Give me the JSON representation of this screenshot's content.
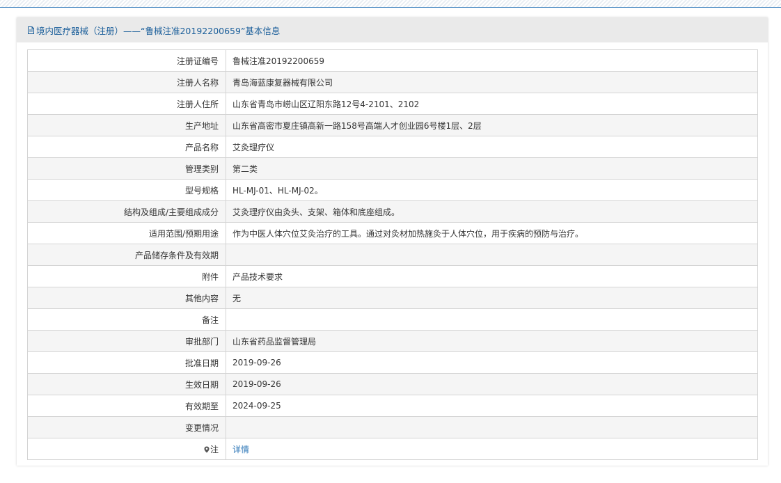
{
  "header": {
    "title": "境内医疗器械（注册）——“鲁械注准20192200659”基本信息"
  },
  "rows": [
    {
      "label": "注册证编号",
      "value": "鲁械注准20192200659"
    },
    {
      "label": "注册人名称",
      "value": "青岛海蓝康复器械有限公司"
    },
    {
      "label": "注册人住所",
      "value": "山东省青岛市崂山区辽阳东路12号4-2101、2102"
    },
    {
      "label": "生产地址",
      "value": "山东省高密市夏庄镇高新一路158号高端人才创业园6号楼1层、2层"
    },
    {
      "label": "产品名称",
      "value": "艾灸理疗仪"
    },
    {
      "label": "管理类别",
      "value": "第二类"
    },
    {
      "label": "型号规格",
      "value": "HL-MJ-01、HL-MJ-02。"
    },
    {
      "label": "结构及组成/主要组成成分",
      "value": "艾灸理疗仪由灸头、支架、箱体和底座组成。"
    },
    {
      "label": "适用范围/预期用途",
      "value": "作为中医人体穴位艾灸治疗的工具。通过对灸材加热施灸于人体穴位，用于疾病的预防与治疗。"
    },
    {
      "label": "产品储存条件及有效期",
      "value": ""
    },
    {
      "label": "附件",
      "value": "产品技术要求"
    },
    {
      "label": "其他内容",
      "value": "无"
    },
    {
      "label": "备注",
      "value": ""
    },
    {
      "label": "审批部门",
      "value": "山东省药品监督管理局"
    },
    {
      "label": "批准日期",
      "value": "2019-09-26"
    },
    {
      "label": "生效日期",
      "value": "2019-09-26"
    },
    {
      "label": "有效期至",
      "value": "2024-09-25"
    },
    {
      "label": "变更情况",
      "value": ""
    }
  ],
  "note_row": {
    "label": "注",
    "icon": "pin-icon",
    "link_text": "详情"
  },
  "colors": {
    "accent": "#2f78b8",
    "header_bg": "#eaeaea",
    "border": "#d4d4d4",
    "stripe_row": "#f5f5f5"
  }
}
